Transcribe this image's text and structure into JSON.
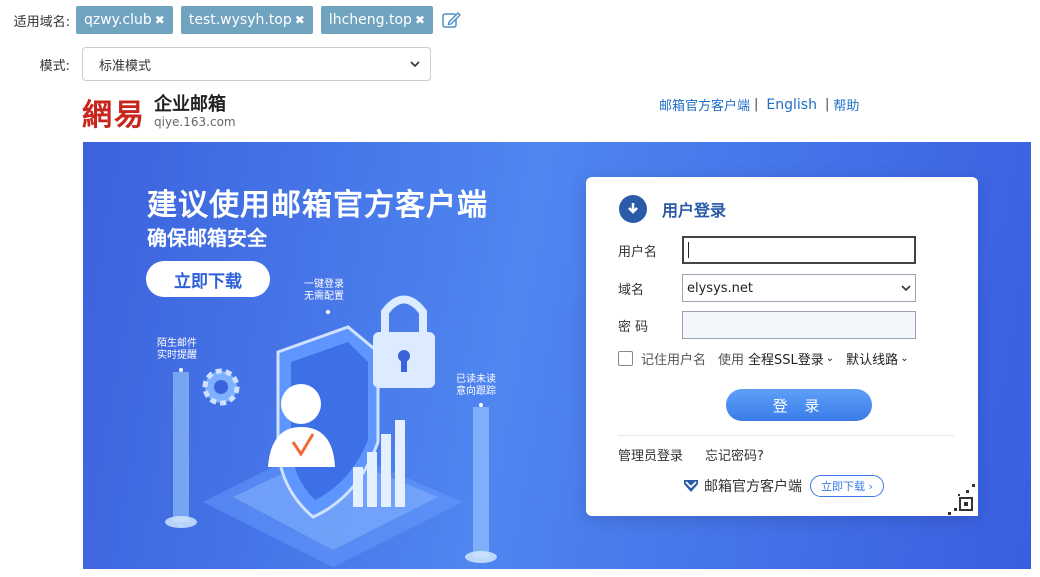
{
  "config": {
    "domains_label": "适用域名:",
    "domains": [
      "qzwy.club",
      "test.wysyh.top",
      "lhcheng.top"
    ],
    "mode_label": "模式:",
    "mode_value": "标准模式"
  },
  "preview": {
    "logo_mark": "網易",
    "logo_cn": "企业邮箱",
    "logo_en": "qiye.163.com",
    "toplinks": {
      "client": "邮箱官方客户端",
      "sep": "|",
      "english": "English",
      "help": "帮助"
    },
    "banner": {
      "title": "建议使用邮箱官方客户端",
      "subtitle": "确保邮箱安全",
      "download_btn": "立即下载",
      "callout_1": "一键登录\n无需配置",
      "callout_2": "陌生邮件\n实时提醒",
      "callout_3": "已读未读\n意向跟踪"
    },
    "login": {
      "title": "用户登录",
      "username_label": "用户名",
      "username_value": "",
      "domain_label": "域名",
      "domain_value": "elysys.net",
      "password_label": "密 码",
      "remember_label": "记住用户名",
      "use_label": "使用",
      "ssl_option": "全程SSL登录",
      "line_option": "默认线路",
      "login_btn": "登 录",
      "admin_link": "管理员登录",
      "forgot_link": "忘记密码?",
      "client_text": "邮箱官方客户端",
      "client_dl": "立即下载 ›"
    }
  },
  "colors": {
    "tag_bg": "#6fa3bf",
    "banner_blue": "#4f86f0",
    "brand_red": "#c8261d",
    "link_blue": "#1f6fc4"
  }
}
